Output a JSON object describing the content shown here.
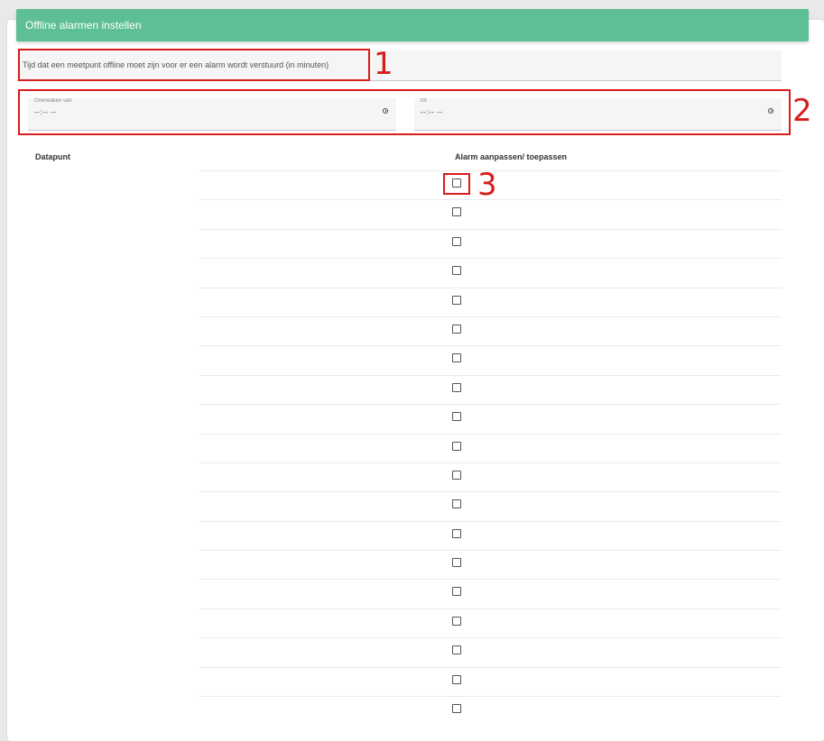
{
  "header": {
    "title": "Offline alarmen instellen",
    "color": "#5dbf93"
  },
  "form": {
    "minutes_placeholder": "Tijd dat een meetpunt offline moet zijn voor er een alarm wordt verstuurd (in minuten)",
    "from_label": "Overwaken van",
    "from_value": "--:-- --",
    "to_label": "tot",
    "to_value": "--:-- --"
  },
  "table": {
    "col_datapunt": "Datapunt",
    "col_alarm": "Alarm aanpassen/ toepassen",
    "row_count": 19
  },
  "annotations": {
    "one": "1",
    "two": "2",
    "three": "3",
    "color": "#d71c1c"
  }
}
